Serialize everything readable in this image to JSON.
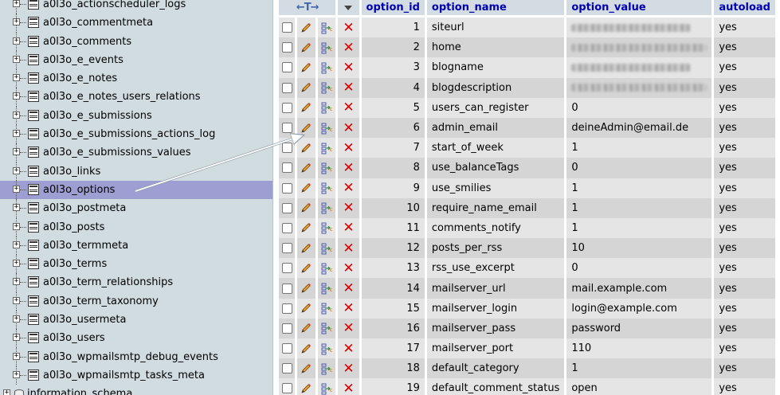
{
  "nav": {
    "tables": [
      "a0l3o_actionscheduler_logs",
      "a0l3o_commentmeta",
      "a0l3o_comments",
      "a0l3o_e_events",
      "a0l3o_e_notes",
      "a0l3o_e_notes_users_relations",
      "a0l3o_e_submissions",
      "a0l3o_e_submissions_actions_log",
      "a0l3o_e_submissions_values",
      "a0l3o_links",
      "a0l3o_options",
      "a0l3o_postmeta",
      "a0l3o_posts",
      "a0l3o_termmeta",
      "a0l3o_terms",
      "a0l3o_term_relationships",
      "a0l3o_term_taxonomy",
      "a0l3o_usermeta",
      "a0l3o_users",
      "a0l3o_wpmailsmtp_debug_events",
      "a0l3o_wpmailsmtp_tasks_meta"
    ],
    "selected_table": "a0l3o_options",
    "database": "information_schema",
    "expander_symbol": "+"
  },
  "grid": {
    "header_arrows": "←T→",
    "columns": [
      "option_id",
      "option_name",
      "option_value",
      "autoload"
    ],
    "rows": [
      {
        "id": "1",
        "name": "siteurl",
        "value": "",
        "redacted": true,
        "autoload": "yes"
      },
      {
        "id": "2",
        "name": "home",
        "value": "",
        "redacted": true,
        "autoload": "yes"
      },
      {
        "id": "3",
        "name": "blogname",
        "value": "",
        "redacted": true,
        "autoload": "yes"
      },
      {
        "id": "4",
        "name": "blogdescription",
        "value": "",
        "redacted": true,
        "autoload": "yes"
      },
      {
        "id": "5",
        "name": "users_can_register",
        "value": "0",
        "redacted": false,
        "autoload": "yes"
      },
      {
        "id": "6",
        "name": "admin_email",
        "value": "deineAdmin@email.de",
        "redacted": false,
        "autoload": "yes"
      },
      {
        "id": "7",
        "name": "start_of_week",
        "value": "1",
        "redacted": false,
        "autoload": "yes"
      },
      {
        "id": "8",
        "name": "use_balanceTags",
        "value": "0",
        "redacted": false,
        "autoload": "yes"
      },
      {
        "id": "9",
        "name": "use_smilies",
        "value": "1",
        "redacted": false,
        "autoload": "yes"
      },
      {
        "id": "10",
        "name": "require_name_email",
        "value": "1",
        "redacted": false,
        "autoload": "yes"
      },
      {
        "id": "11",
        "name": "comments_notify",
        "value": "1",
        "redacted": false,
        "autoload": "yes"
      },
      {
        "id": "12",
        "name": "posts_per_rss",
        "value": "10",
        "redacted": false,
        "autoload": "yes"
      },
      {
        "id": "13",
        "name": "rss_use_excerpt",
        "value": "0",
        "redacted": false,
        "autoload": "yes"
      },
      {
        "id": "14",
        "name": "mailserver_url",
        "value": "mail.example.com",
        "redacted": false,
        "autoload": "yes"
      },
      {
        "id": "15",
        "name": "mailserver_login",
        "value": "login@example.com",
        "redacted": false,
        "autoload": "yes"
      },
      {
        "id": "16",
        "name": "mailserver_pass",
        "value": "password",
        "redacted": false,
        "autoload": "yes"
      },
      {
        "id": "17",
        "name": "mailserver_port",
        "value": "110",
        "redacted": false,
        "autoload": "yes"
      },
      {
        "id": "18",
        "name": "default_category",
        "value": "1",
        "redacted": false,
        "autoload": "yes"
      },
      {
        "id": "19",
        "name": "default_comment_status",
        "value": "open",
        "redacted": false,
        "autoload": "yes"
      }
    ],
    "delete_glyph": "✕"
  },
  "colors": {
    "nav_bg": "#d0dce0",
    "selected_row": "#9d9fd2",
    "header_bg": "#d3dce3",
    "header_text": "#0000b0",
    "row_odd": "#e5e5e5",
    "row_even": "#d5d5d5",
    "delete_red": "#dd0000"
  }
}
